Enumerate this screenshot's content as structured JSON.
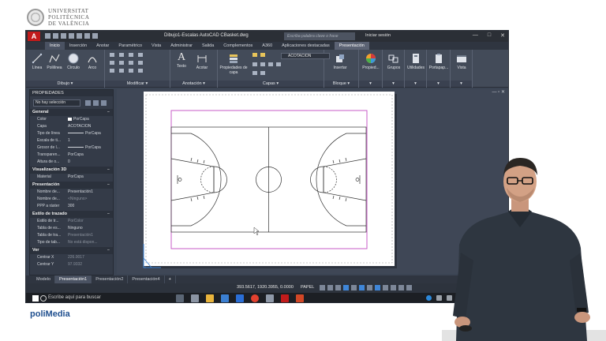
{
  "university": {
    "lines": [
      "UNIVERSITAT",
      "POLITÈCNICA",
      "DE VALÈNCIA"
    ]
  },
  "branding": {
    "polimedia": "poliMedia"
  },
  "app": {
    "logo": "A",
    "document_title": "Dibujo1-Escalas AutoCAD CBasket.dwg",
    "search_placeholder": "Escriba palabra clave o frase",
    "signin": "Iniciar sesión",
    "window_controls": [
      "—",
      "□",
      "✕"
    ]
  },
  "ribbon_tabs": [
    {
      "label": "Inicio",
      "active": true
    },
    {
      "label": "Inserción",
      "active": false
    },
    {
      "label": "Anotar",
      "active": false
    },
    {
      "label": "Paramétrico",
      "active": false
    },
    {
      "label": "Vista",
      "active": false
    },
    {
      "label": "Administrar",
      "active": false
    },
    {
      "label": "Salida",
      "active": false
    },
    {
      "label": "Complementos",
      "active": false
    },
    {
      "label": "A360",
      "active": false
    },
    {
      "label": "Aplicaciones destacadas",
      "active": false
    },
    {
      "label": "Presentación",
      "active": false
    }
  ],
  "ribbon": {
    "groups": {
      "dibujo": "Dibujo ▾",
      "modificar": "Modificar ▾",
      "anotacion": "Anotación ▾",
      "capas": "Capas ▾",
      "bloque": "Bloque ▾"
    },
    "buttons": {
      "linea": "Línea",
      "polilinea": "Polilínea",
      "circulo": "Círculo",
      "arco": "Arco",
      "texto": "Texto",
      "acotar": "Acotar",
      "propiedades_capa": "Propiedades de capa",
      "insertar": "Insertar",
      "propiedades": "Propied...",
      "grupos": "Grupos",
      "utilidades": "Utilidades",
      "portapapeles": "Portapap...",
      "vista": "Vista"
    },
    "layer_name": "ACOTACION"
  },
  "properties": {
    "title": "PROPIEDADES",
    "selection": "No hay selección",
    "sections": [
      {
        "title": "General",
        "rows": [
          {
            "key": "Color",
            "value": "PorCapa",
            "type": "color"
          },
          {
            "key": "Capa",
            "value": "ACOTACION"
          },
          {
            "key": "Tipo de línea",
            "value": "PorCapa",
            "type": "line"
          },
          {
            "key": "Escala de ti...",
            "value": "1"
          },
          {
            "key": "Grosor de l...",
            "value": "PorCapa",
            "type": "line"
          },
          {
            "key": "Transparen...",
            "value": "PorCapa"
          },
          {
            "key": "Altura de o...",
            "value": "0"
          }
        ]
      },
      {
        "title": "Visualización 3D",
        "rows": [
          {
            "key": "Material",
            "value": "PorCapa"
          }
        ]
      },
      {
        "title": "Presentación",
        "rows": [
          {
            "key": "Nombre de...",
            "value": "Presentación1"
          },
          {
            "key": "Nombre de...",
            "value": "<Ninguno>",
            "dim": true
          },
          {
            "key": "PPP a ráster",
            "value": "300"
          }
        ]
      },
      {
        "title": "Estilo de trazado",
        "rows": [
          {
            "key": "Estilo de tr...",
            "value": "PorColor",
            "dim": true
          },
          {
            "key": "Tabla de es...",
            "value": "Ninguno"
          },
          {
            "key": "Tabla de tra...",
            "value": "Presentación1",
            "dim": true
          },
          {
            "key": "Tipo de tab...",
            "value": "No está dispon...",
            "dim": true
          }
        ]
      },
      {
        "title": "Ver",
        "rows": [
          {
            "key": "Centrar X",
            "value": "226.0017",
            "dim": true
          },
          {
            "key": "Centrar Y",
            "value": "97.9332",
            "dim": true
          }
        ]
      }
    ]
  },
  "layout_tabs": [
    {
      "label": "Modelo",
      "active": false
    },
    {
      "label": "Presentación1",
      "active": true
    },
    {
      "label": "Presentación2",
      "active": false
    },
    {
      "label": "Presentación4",
      "active": false
    },
    {
      "label": "+",
      "active": false
    }
  ],
  "status": {
    "coords": "393.5617, 1920.3955, 0.0000",
    "mode": "PAPEL"
  },
  "taskbar": {
    "search": "Escribe aquí para buscar"
  },
  "colors": {
    "viewport_border": "#c75bc7",
    "autocad_red": "#c21b1b",
    "accent_blue": "#3f86d8"
  }
}
